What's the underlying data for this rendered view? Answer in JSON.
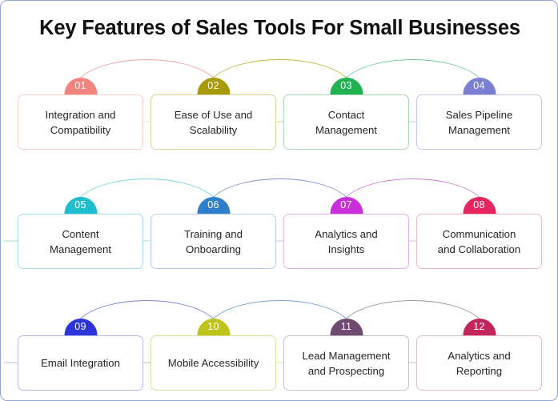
{
  "page": {
    "title": "Key Features of Sales Tools For Small Businesses",
    "background_color": "#ffffff",
    "border_color": "#8fa3de"
  },
  "rows": [
    {
      "cells": [
        {
          "number": "01",
          "label": "Integration and\nCompatibility",
          "badge_color": "#f4827d",
          "card_border": "#f6cfcd",
          "arc_color": "#e98f91"
        },
        {
          "number": "02",
          "label": "Ease of Use and\nScalability",
          "badge_color": "#a89a06",
          "card_border": "#d8d49a",
          "arc_color": "#b3a91c"
        },
        {
          "number": "03",
          "label": "Contact\nManagement",
          "badge_color": "#1fb451",
          "card_border": "#a8d8b8",
          "arc_color": "#57bd8a"
        },
        {
          "number": "04",
          "label": "Sales Pipeline\nManagement",
          "badge_color": "#7b7fd4",
          "card_border": "#c5c6e8",
          "arc_color": "#8e92da"
        }
      ]
    },
    {
      "cells": [
        {
          "number": "05",
          "label": "Content\nManagement",
          "badge_color": "#1fbecf",
          "card_border": "#a7dde6",
          "arc_color": "#63cdd8"
        },
        {
          "number": "06",
          "label": "Training and\nOnboarding",
          "badge_color": "#2e7ecb",
          "card_border": "#b6cfe8",
          "arc_color": "#6f7fc4"
        },
        {
          "number": "07",
          "label": "Analytics and\nInsights",
          "badge_color": "#c930dc",
          "card_border": "#e2b4e8",
          "arc_color": "#c464c6"
        },
        {
          "number": "08",
          "label": "Communication\nand Collaboration",
          "badge_color": "#e6245f",
          "card_border": "#efb9c9",
          "arc_color": "#d86a95"
        }
      ]
    },
    {
      "cells": [
        {
          "number": "09",
          "label": "Email Integration",
          "badge_color": "#2b35d9",
          "card_border": "#b7bbe8",
          "arc_color": "#6a6fc9"
        },
        {
          "number": "10",
          "label": "Mobile Accessibility",
          "badge_color": "#bfc41a",
          "card_border": "#dcdf9e",
          "arc_color": "#5c93c4"
        },
        {
          "number": "11",
          "label": "Lead Management\nand Prospecting",
          "badge_color": "#6e4a70",
          "card_border": "#c5c0c6",
          "arc_color": "#8a7d8d"
        },
        {
          "number": "12",
          "label": "Analytics and\nReporting",
          "badge_color": "#c2255c",
          "card_border": "#e3bac8",
          "arc_color": "#c2255c"
        }
      ]
    }
  ]
}
